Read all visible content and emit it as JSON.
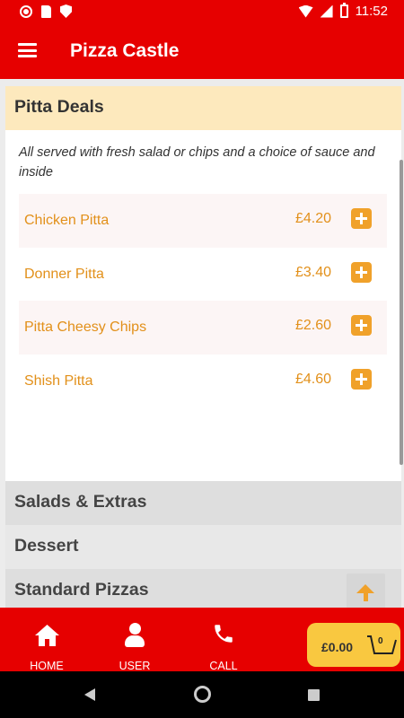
{
  "status_bar": {
    "time": "11:52"
  },
  "app_bar": {
    "title": "Pizza Castle"
  },
  "section": {
    "title": "Pitta Deals",
    "description": "All served with fresh salad or chips and a choice of sauce and inside",
    "items": [
      {
        "name": "Chicken Pitta",
        "price": "£4.20"
      },
      {
        "name": "Donner Pitta",
        "price": "£3.40"
      },
      {
        "name": "Pitta Cheesy Chips",
        "price": "£2.60"
      },
      {
        "name": "Shish Pitta",
        "price": "£4.60"
      }
    ]
  },
  "categories": [
    "Salads & Extras",
    "Dessert",
    "Standard Pizzas"
  ],
  "bottom_nav": {
    "home": "HOME",
    "user": "USER",
    "call": "CALL"
  },
  "cart": {
    "total": "£0.00",
    "count": "0"
  },
  "colors": {
    "brand": "#e60000",
    "accent": "#f0a12a",
    "header_bg": "#fde9bd",
    "cart_bg": "#f9c840"
  }
}
